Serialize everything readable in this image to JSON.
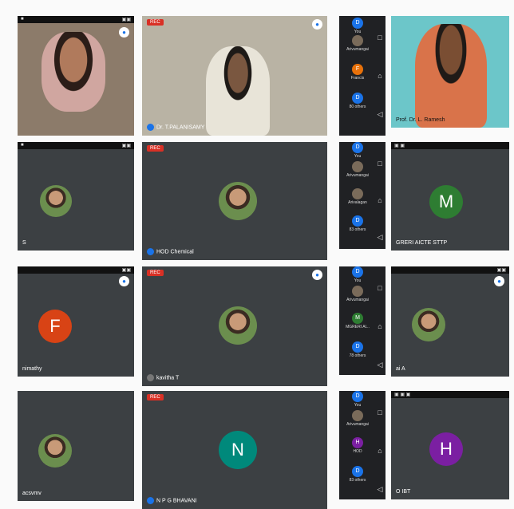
{
  "row1": {
    "left_name": "",
    "center_rec": "REC",
    "center_name": "Dr. T.PALANISAMY",
    "side": {
      "chip1_label": "You",
      "chip2_label": "Arivumangai",
      "chip3_letter": "F",
      "chip3_label": "Francis",
      "chip4_letter": "D",
      "chip4_label": "80 others"
    },
    "right_name": "Prof. Dr. L. Ramesh"
  },
  "row2": {
    "left_name": "S",
    "center_rec": "REC",
    "center_name": "HOD Chemical",
    "side": {
      "chip1_label": "You",
      "chip2_label": "Arivumangai",
      "chip3_label": "Arivalagan",
      "chip4_letter": "D",
      "chip4_label": "83 others"
    },
    "right_letter": "M",
    "right_name": "GRERI AICTE STTP"
  },
  "row3": {
    "left_letter": "F",
    "left_name": "nimathy",
    "center_rec": "REC",
    "center_name": "kavitha T",
    "side": {
      "chip1_label": "You",
      "chip2_label": "Arivumangai",
      "chip3_letter": "M",
      "chip3_label": "MGRERI Al...",
      "chip4_letter": "D",
      "chip4_label": "78 others"
    },
    "right_name": "ai A"
  },
  "row4": {
    "left_name": "acsvmv",
    "center_rec": "REC",
    "center_letter": "N",
    "center_name": "N P G BHAVANI",
    "side": {
      "chip1_label": "You",
      "chip2_label": "Arivumangai",
      "chip3_letter": "H",
      "chip3_label": "HOD",
      "chip4_letter": "D",
      "chip4_label": "83 others"
    },
    "right_letter": "H",
    "right_name": "O IBT"
  }
}
